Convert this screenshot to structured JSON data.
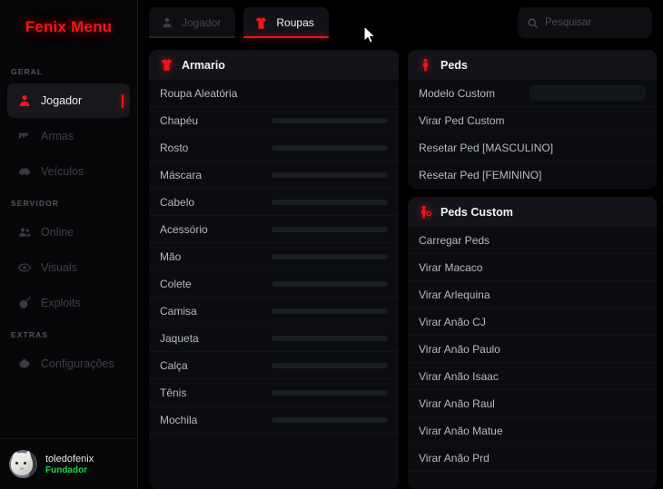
{
  "brand": {
    "title": "Fenix Menu",
    "accent": "#ef1616"
  },
  "sidebar": {
    "sections": [
      {
        "label": "GERAL"
      },
      {
        "label": "SERVIDOR"
      },
      {
        "label": "EXTRAS"
      }
    ],
    "items": [
      {
        "label": "Jogador",
        "icon": "person-icon",
        "active": true
      },
      {
        "label": "Armas",
        "icon": "gun-icon",
        "active": false
      },
      {
        "label": "Veículos",
        "icon": "car-icon",
        "active": false
      },
      {
        "label": "Online",
        "icon": "people-icon",
        "active": false
      },
      {
        "label": "Visuals",
        "icon": "eye-icon",
        "active": false
      },
      {
        "label": "Exploits",
        "icon": "bomb-icon",
        "active": false
      },
      {
        "label": "Configurações",
        "icon": "gear-icon",
        "active": false
      }
    ],
    "profile": {
      "name": "toledofenix",
      "role": "Fundador",
      "role_color": "#1fd34a",
      "avatar": "cat-avatar"
    }
  },
  "topbar": {
    "tabs": [
      {
        "label": "Jogador",
        "icon": "person-icon",
        "active": false
      },
      {
        "label": "Roupas",
        "icon": "tshirt-icon",
        "active": true
      }
    ],
    "search": {
      "placeholder": "Pesquisar",
      "value": "",
      "icon": "search-icon"
    }
  },
  "panels": {
    "armario": {
      "title": "Armario",
      "icon": "tshirt-icon",
      "rows": [
        {
          "label": "Roupa Aleatória",
          "control": "none"
        },
        {
          "label": "Chapéu",
          "control": "slider"
        },
        {
          "label": "Rosto",
          "control": "slider"
        },
        {
          "label": "Máscara",
          "control": "slider"
        },
        {
          "label": "Cabelo",
          "control": "slider"
        },
        {
          "label": "Acessório",
          "control": "slider"
        },
        {
          "label": "Mão",
          "control": "slider"
        },
        {
          "label": "Colete",
          "control": "slider"
        },
        {
          "label": "Camisa",
          "control": "slider"
        },
        {
          "label": "Jaqueta",
          "control": "slider"
        },
        {
          "label": "Calça",
          "control": "slider"
        },
        {
          "label": "Tênis",
          "control": "slider"
        },
        {
          "label": "Mochila",
          "control": "slider"
        }
      ]
    },
    "peds": {
      "title": "Peds",
      "icon": "ped-icon",
      "rows": [
        {
          "label": "Modelo Custom",
          "control": "textbox"
        },
        {
          "label": "Virar Ped Custom",
          "control": "none"
        },
        {
          "label": "Resetar Ped [MASCULINO]",
          "control": "none"
        },
        {
          "label": "Resetar Ped [FEMININO]",
          "control": "none"
        }
      ]
    },
    "peds_custom": {
      "title": "Peds Custom",
      "icon": "ped-add-icon",
      "rows": [
        {
          "label": "Carregar Peds",
          "control": "none"
        },
        {
          "label": "Virar Macaco",
          "control": "none"
        },
        {
          "label": "Virar Arlequina",
          "control": "none"
        },
        {
          "label": "Virar Anão CJ",
          "control": "none"
        },
        {
          "label": "Virar Anão Paulo",
          "control": "none"
        },
        {
          "label": "Virar Anão Isaac",
          "control": "none"
        },
        {
          "label": "Virar Anão Raul",
          "control": "none"
        },
        {
          "label": "Virar Anão Matue",
          "control": "none"
        },
        {
          "label": "Virar Anão Prd",
          "control": "none"
        }
      ]
    }
  }
}
